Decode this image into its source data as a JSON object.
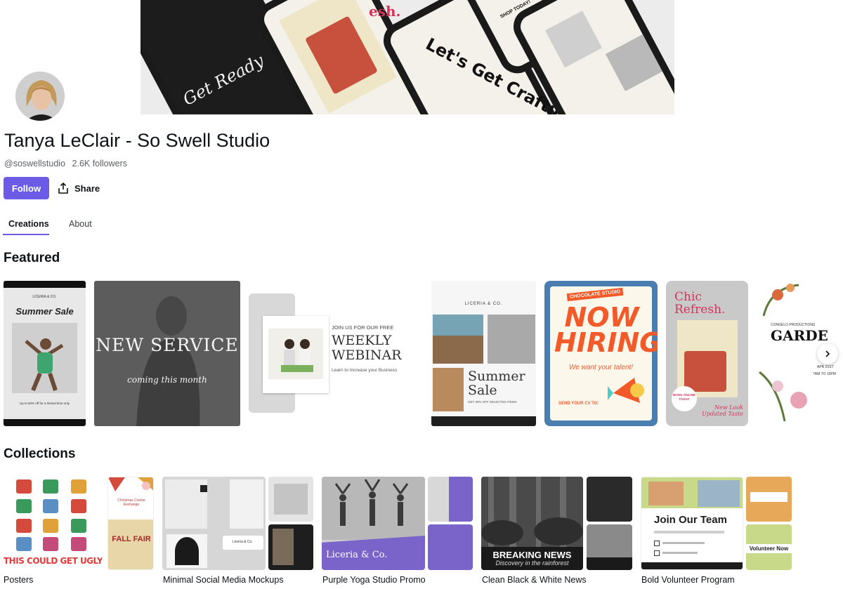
{
  "banner": {
    "script_text": "Get Ready",
    "big_text": "Let's Get Craftin",
    "phone_badge": "SHOP TODAY!",
    "fresh_text": "esh."
  },
  "profile": {
    "name": "Tanya LeClair - So Swell Studio",
    "handle": "@soswellstudio",
    "followers": "2.6K followers",
    "follow_label": "Follow",
    "share_label": "Share"
  },
  "tabs": [
    {
      "label": "Creations",
      "active": true
    },
    {
      "label": "About",
      "active": false
    }
  ],
  "featured": {
    "title": "Featured",
    "items": [
      {
        "name": "summer-sale-poster",
        "top": "LICERIA & CO.",
        "heading": "Summer Sale",
        "foot": "Up to 50% off for a limited time only"
      },
      {
        "name": "new-service-post",
        "heading": "NEW SERVICE",
        "sub": "coming this month"
      },
      {
        "name": "weekly-webinar-post",
        "top": "JOIN US FOR OUR FREE",
        "heading": "WEEKLY WEBINAR",
        "sub": "Learn to Increase your Business"
      },
      {
        "name": "summer-sale-collage",
        "top": "LICERIA & CO.",
        "heading": "Summer Sale",
        "sub": "GET 30% OFF SELECTED ITEMS"
      },
      {
        "name": "now-hiring-poster",
        "top": "CHOCOLATE STUDIO",
        "heading": "NOW HIRING",
        "sub": "We want your talent!",
        "foot": "SEND YOUR CV TO:"
      },
      {
        "name": "chic-refresh-story",
        "heading": "Chic Refresh.",
        "badge": "BOOK ONLINE TODAY",
        "foot": "New Look Updated Taste"
      },
      {
        "name": "garden-party-invite",
        "top": "CONGELO PRODUCTIONS",
        "heading": "GARDE",
        "sub": "APR 21ST",
        "foot": "7AM TO 10PM"
      }
    ]
  },
  "collections": {
    "title": "Collections",
    "items": [
      {
        "label": "Posters",
        "big_text": "THIS COULD GET UGLY",
        "side_heading": "FALL FAIR",
        "side_top": "Christmas Cookie Exchange"
      },
      {
        "label": "Minimal Social Media Mockups",
        "brand": "Liceria & Co."
      },
      {
        "label": "Purple Yoga Studio Promo",
        "brand": "Liceria & Co."
      },
      {
        "label": "Clean Black & White News",
        "heading": "BREAKING NEWS",
        "sub": "Discovery in the rainforest"
      },
      {
        "label": "Bold Volunteer Program",
        "heading": "Join Our Team",
        "sub": "Volunteer Now"
      }
    ]
  },
  "colors": {
    "accent": "#6b5be6",
    "hiring_blue": "#4a7eb0",
    "hiring_orange": "#f35a2a",
    "yoga_purple": "#7a63c9"
  }
}
